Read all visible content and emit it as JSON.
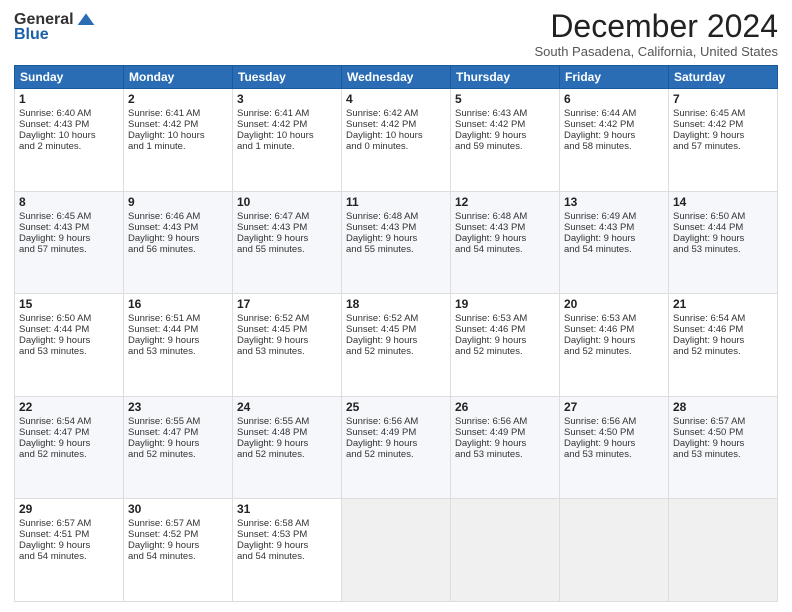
{
  "logo": {
    "general": "General",
    "blue": "Blue"
  },
  "header": {
    "month": "December 2024",
    "location": "South Pasadena, California, United States"
  },
  "days_header": [
    "Sunday",
    "Monday",
    "Tuesday",
    "Wednesday",
    "Thursday",
    "Friday",
    "Saturday"
  ],
  "weeks": [
    [
      {
        "day": 1,
        "lines": [
          "Sunrise: 6:40 AM",
          "Sunset: 4:43 PM",
          "Daylight: 10 hours",
          "and 2 minutes."
        ]
      },
      {
        "day": 2,
        "lines": [
          "Sunrise: 6:41 AM",
          "Sunset: 4:42 PM",
          "Daylight: 10 hours",
          "and 1 minute."
        ]
      },
      {
        "day": 3,
        "lines": [
          "Sunrise: 6:41 AM",
          "Sunset: 4:42 PM",
          "Daylight: 10 hours",
          "and 1 minute."
        ]
      },
      {
        "day": 4,
        "lines": [
          "Sunrise: 6:42 AM",
          "Sunset: 4:42 PM",
          "Daylight: 10 hours",
          "and 0 minutes."
        ]
      },
      {
        "day": 5,
        "lines": [
          "Sunrise: 6:43 AM",
          "Sunset: 4:42 PM",
          "Daylight: 9 hours",
          "and 59 minutes."
        ]
      },
      {
        "day": 6,
        "lines": [
          "Sunrise: 6:44 AM",
          "Sunset: 4:42 PM",
          "Daylight: 9 hours",
          "and 58 minutes."
        ]
      },
      {
        "day": 7,
        "lines": [
          "Sunrise: 6:45 AM",
          "Sunset: 4:42 PM",
          "Daylight: 9 hours",
          "and 57 minutes."
        ]
      }
    ],
    [
      {
        "day": 8,
        "lines": [
          "Sunrise: 6:45 AM",
          "Sunset: 4:43 PM",
          "Daylight: 9 hours",
          "and 57 minutes."
        ]
      },
      {
        "day": 9,
        "lines": [
          "Sunrise: 6:46 AM",
          "Sunset: 4:43 PM",
          "Daylight: 9 hours",
          "and 56 minutes."
        ]
      },
      {
        "day": 10,
        "lines": [
          "Sunrise: 6:47 AM",
          "Sunset: 4:43 PM",
          "Daylight: 9 hours",
          "and 55 minutes."
        ]
      },
      {
        "day": 11,
        "lines": [
          "Sunrise: 6:48 AM",
          "Sunset: 4:43 PM",
          "Daylight: 9 hours",
          "and 55 minutes."
        ]
      },
      {
        "day": 12,
        "lines": [
          "Sunrise: 6:48 AM",
          "Sunset: 4:43 PM",
          "Daylight: 9 hours",
          "and 54 minutes."
        ]
      },
      {
        "day": 13,
        "lines": [
          "Sunrise: 6:49 AM",
          "Sunset: 4:43 PM",
          "Daylight: 9 hours",
          "and 54 minutes."
        ]
      },
      {
        "day": 14,
        "lines": [
          "Sunrise: 6:50 AM",
          "Sunset: 4:44 PM",
          "Daylight: 9 hours",
          "and 53 minutes."
        ]
      }
    ],
    [
      {
        "day": 15,
        "lines": [
          "Sunrise: 6:50 AM",
          "Sunset: 4:44 PM",
          "Daylight: 9 hours",
          "and 53 minutes."
        ]
      },
      {
        "day": 16,
        "lines": [
          "Sunrise: 6:51 AM",
          "Sunset: 4:44 PM",
          "Daylight: 9 hours",
          "and 53 minutes."
        ]
      },
      {
        "day": 17,
        "lines": [
          "Sunrise: 6:52 AM",
          "Sunset: 4:45 PM",
          "Daylight: 9 hours",
          "and 53 minutes."
        ]
      },
      {
        "day": 18,
        "lines": [
          "Sunrise: 6:52 AM",
          "Sunset: 4:45 PM",
          "Daylight: 9 hours",
          "and 52 minutes."
        ]
      },
      {
        "day": 19,
        "lines": [
          "Sunrise: 6:53 AM",
          "Sunset: 4:46 PM",
          "Daylight: 9 hours",
          "and 52 minutes."
        ]
      },
      {
        "day": 20,
        "lines": [
          "Sunrise: 6:53 AM",
          "Sunset: 4:46 PM",
          "Daylight: 9 hours",
          "and 52 minutes."
        ]
      },
      {
        "day": 21,
        "lines": [
          "Sunrise: 6:54 AM",
          "Sunset: 4:46 PM",
          "Daylight: 9 hours",
          "and 52 minutes."
        ]
      }
    ],
    [
      {
        "day": 22,
        "lines": [
          "Sunrise: 6:54 AM",
          "Sunset: 4:47 PM",
          "Daylight: 9 hours",
          "and 52 minutes."
        ]
      },
      {
        "day": 23,
        "lines": [
          "Sunrise: 6:55 AM",
          "Sunset: 4:47 PM",
          "Daylight: 9 hours",
          "and 52 minutes."
        ]
      },
      {
        "day": 24,
        "lines": [
          "Sunrise: 6:55 AM",
          "Sunset: 4:48 PM",
          "Daylight: 9 hours",
          "and 52 minutes."
        ]
      },
      {
        "day": 25,
        "lines": [
          "Sunrise: 6:56 AM",
          "Sunset: 4:49 PM",
          "Daylight: 9 hours",
          "and 52 minutes."
        ]
      },
      {
        "day": 26,
        "lines": [
          "Sunrise: 6:56 AM",
          "Sunset: 4:49 PM",
          "Daylight: 9 hours",
          "and 53 minutes."
        ]
      },
      {
        "day": 27,
        "lines": [
          "Sunrise: 6:56 AM",
          "Sunset: 4:50 PM",
          "Daylight: 9 hours",
          "and 53 minutes."
        ]
      },
      {
        "day": 28,
        "lines": [
          "Sunrise: 6:57 AM",
          "Sunset: 4:50 PM",
          "Daylight: 9 hours",
          "and 53 minutes."
        ]
      }
    ],
    [
      {
        "day": 29,
        "lines": [
          "Sunrise: 6:57 AM",
          "Sunset: 4:51 PM",
          "Daylight: 9 hours",
          "and 54 minutes."
        ]
      },
      {
        "day": 30,
        "lines": [
          "Sunrise: 6:57 AM",
          "Sunset: 4:52 PM",
          "Daylight: 9 hours",
          "and 54 minutes."
        ]
      },
      {
        "day": 31,
        "lines": [
          "Sunrise: 6:58 AM",
          "Sunset: 4:53 PM",
          "Daylight: 9 hours",
          "and 54 minutes."
        ]
      },
      null,
      null,
      null,
      null
    ]
  ]
}
